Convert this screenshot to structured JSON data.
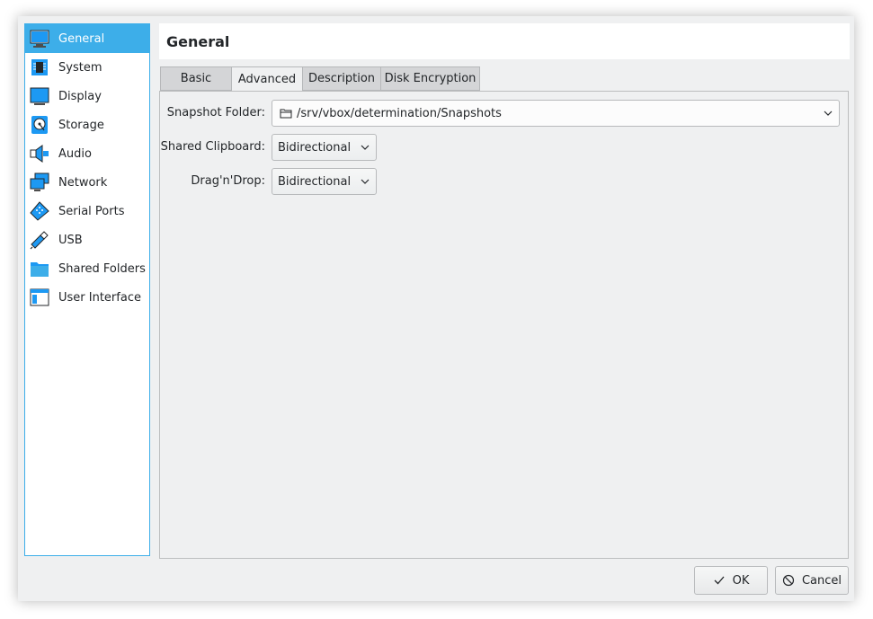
{
  "sidebar": {
    "items": [
      {
        "label": "General",
        "icon": "monitor-icon"
      },
      {
        "label": "System",
        "icon": "chip-icon"
      },
      {
        "label": "Display",
        "icon": "display-icon"
      },
      {
        "label": "Storage",
        "icon": "disk-icon"
      },
      {
        "label": "Audio",
        "icon": "speaker-icon"
      },
      {
        "label": "Network",
        "icon": "network-icon"
      },
      {
        "label": "Serial Ports",
        "icon": "serial-port-icon"
      },
      {
        "label": "USB",
        "icon": "usb-icon"
      },
      {
        "label": "Shared Folders",
        "icon": "folder-icon"
      },
      {
        "label": "User Interface",
        "icon": "window-icon"
      }
    ],
    "selected": "General"
  },
  "header": {
    "title": "General"
  },
  "tabs": [
    {
      "label": "Basic"
    },
    {
      "label": "Advanced"
    },
    {
      "label": "Description"
    },
    {
      "label": "Disk Encryption"
    }
  ],
  "active_tab": "Advanced",
  "form": {
    "snapshot_folder": {
      "label": "Snapshot Folder:",
      "value": "/srv/vbox/determination/Snapshots"
    },
    "shared_clipboard": {
      "label": "Shared Clipboard:",
      "value": "Bidirectional"
    },
    "drag_n_drop": {
      "label": "Drag'n'Drop:",
      "value": "Bidirectional"
    }
  },
  "buttons": {
    "ok": {
      "label": "OK",
      "icon": "checkmark-icon"
    },
    "cancel": {
      "label": "Cancel",
      "icon": "cancel-icon"
    }
  },
  "colors": {
    "accent": "#3daee9",
    "icon_blue": "#1d99f3",
    "window_bg": "#eff0f1"
  }
}
